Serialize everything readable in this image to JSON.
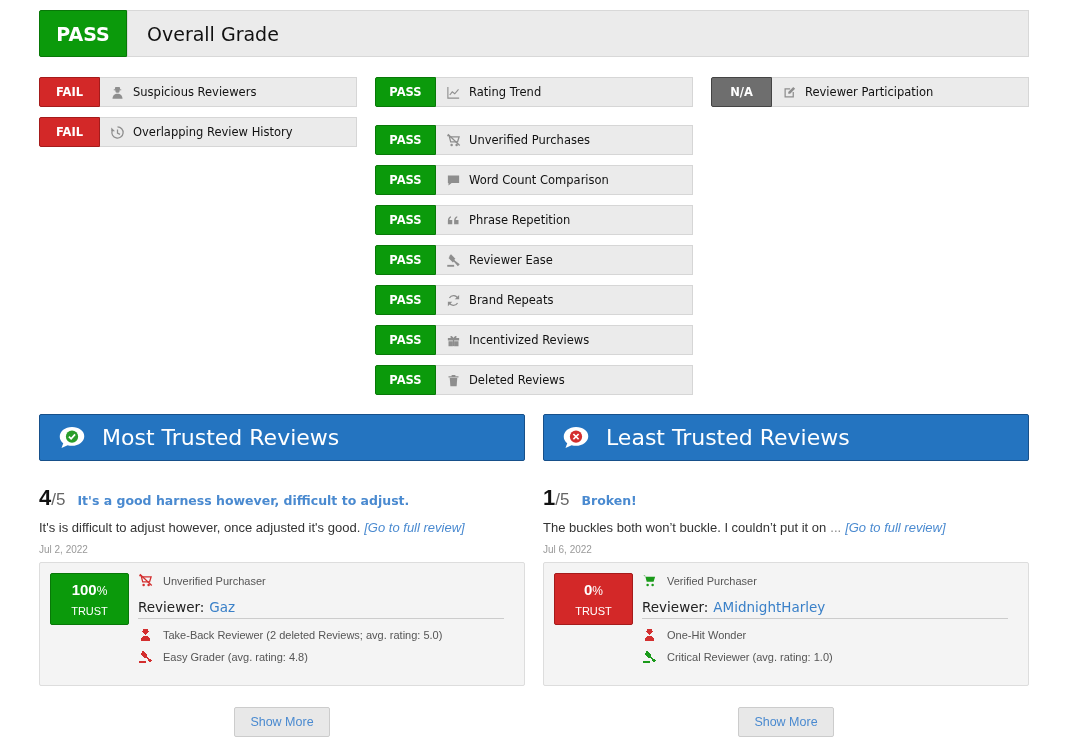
{
  "overall": {
    "badge": {
      "kind": "pass",
      "text": "PASS"
    },
    "label": "Overall Grade"
  },
  "columns": [
    {
      "groups": [
        [
          {
            "badge": {
              "kind": "fail",
              "text": "FAIL"
            },
            "kind": "spy",
            "label": "Suspicious Reviewers"
          },
          {
            "badge": {
              "kind": "fail",
              "text": "FAIL"
            },
            "kind": "history",
            "label": "Overlapping Review History"
          }
        ]
      ]
    },
    {
      "groups": [
        [
          {
            "badge": {
              "kind": "pass",
              "text": "PASS"
            },
            "kind": "trend",
            "label": "Rating Trend"
          }
        ],
        [
          {
            "badge": {
              "kind": "pass",
              "text": "PASS"
            },
            "kind": "cartslash",
            "label": "Unverified Purchases"
          },
          {
            "badge": {
              "kind": "pass",
              "text": "PASS"
            },
            "kind": "comment",
            "label": "Word Count Comparison"
          },
          {
            "badge": {
              "kind": "pass",
              "text": "PASS"
            },
            "kind": "quote",
            "label": "Phrase Repetition"
          },
          {
            "badge": {
              "kind": "pass",
              "text": "PASS"
            },
            "kind": "gavel",
            "label": "Reviewer Ease"
          },
          {
            "badge": {
              "kind": "pass",
              "text": "PASS"
            },
            "kind": "sync",
            "label": "Brand Repeats"
          },
          {
            "badge": {
              "kind": "pass",
              "text": "PASS"
            },
            "kind": "gift",
            "label": "Incentivized Reviews"
          },
          {
            "badge": {
              "kind": "pass",
              "text": "PASS"
            },
            "kind": "trash",
            "label": "Deleted Reviews"
          }
        ]
      ]
    },
    {
      "groups": [
        [
          {
            "badge": {
              "kind": "na",
              "text": "N/A"
            },
            "kind": "edit",
            "label": "Reviewer Participation"
          }
        ]
      ]
    }
  ],
  "panels": [
    {
      "kind": "trusted",
      "title": "Most Trusted Reviews",
      "rating": "4",
      "out_of": "/5",
      "review_title": "It's a good harness however, difficult to adjust.",
      "body": "It's is difficult to adjust however, once adjusted it's good.",
      "link": "[Go to full review]",
      "date": "Jul 2, 2022",
      "trust": {
        "kind": "pass",
        "value": "100",
        "unit": "%",
        "label": "TRUST"
      },
      "purchase": {
        "kind": "unverified",
        "text": "Unverified Purchaser"
      },
      "reviewer_label": "Reviewer:",
      "reviewer": "Gaz",
      "badges": [
        {
          "kind": "spy",
          "color": "#d32f2f",
          "text": "Take-Back Reviewer (2 deleted Reviews; avg. rating: 5.0)"
        },
        {
          "kind": "gavel",
          "color": "#d32f2f",
          "text": "Easy Grader (avg. rating: 4.8)"
        }
      ],
      "button": "Show More"
    },
    {
      "kind": "untrusted",
      "title": "Least Trusted Reviews",
      "rating": "1",
      "out_of": "/5",
      "review_title": "Broken!",
      "body": "The buckles both won’t buckle. I couldn’t put it on",
      "ellipsis": "...",
      "link": "[Go to full review]",
      "date": "Jul 6, 2022",
      "trust": {
        "kind": "fail",
        "value": "0",
        "unit": "%",
        "label": "TRUST"
      },
      "purchase": {
        "kind": "verified",
        "text": "Verified Purchaser"
      },
      "reviewer_label": "Reviewer:",
      "reviewer": "AMidnightHarley",
      "badges": [
        {
          "kind": "spy",
          "color": "#d32f2f",
          "text": "One-Hit Wonder"
        },
        {
          "kind": "gavel",
          "color": "#1a9a1a",
          "text": "Critical Reviewer (avg. rating: 1.0)"
        }
      ],
      "button": "Show More"
    }
  ]
}
